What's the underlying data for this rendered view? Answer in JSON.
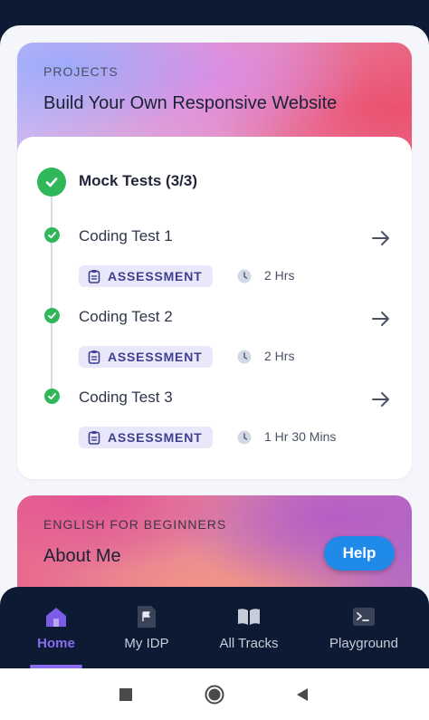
{
  "project": {
    "eyebrow": "PROJECTS",
    "title": "Build Your Own Responsive Website"
  },
  "section": {
    "title": "Mock Tests (3/3)",
    "status_icon": "check-circle-icon"
  },
  "items": [
    {
      "title": "Coding Test 1",
      "badge": "ASSESSMENT",
      "duration": "2 Hrs"
    },
    {
      "title": "Coding Test 2",
      "badge": "ASSESSMENT",
      "duration": "2 Hrs"
    },
    {
      "title": "Coding Test 3",
      "badge": "ASSESSMENT",
      "duration": "1 Hr 30 Mins"
    }
  ],
  "next_card": {
    "eyebrow": "ENGLISH FOR BEGINNERS",
    "title": "About Me"
  },
  "help": {
    "label": "Help"
  },
  "nav": {
    "items": [
      {
        "label": "Home",
        "icon": "home-icon",
        "active": true
      },
      {
        "label": "My IDP",
        "icon": "document-flag-icon",
        "active": false
      },
      {
        "label": "All Tracks",
        "icon": "open-book-icon",
        "active": false
      },
      {
        "label": "Playground",
        "icon": "terminal-icon",
        "active": false
      }
    ]
  },
  "colors": {
    "success": "#2fb75a",
    "accent": "#8a6cf0",
    "help_button": "#1f8ae8",
    "nav_bg": "#0c1a33",
    "badge_bg": "#e9e8fb",
    "badge_text": "#3f3f90"
  },
  "system_nav": {
    "items": [
      "recents-square-icon",
      "home-circle-icon",
      "back-triangle-icon"
    ]
  }
}
